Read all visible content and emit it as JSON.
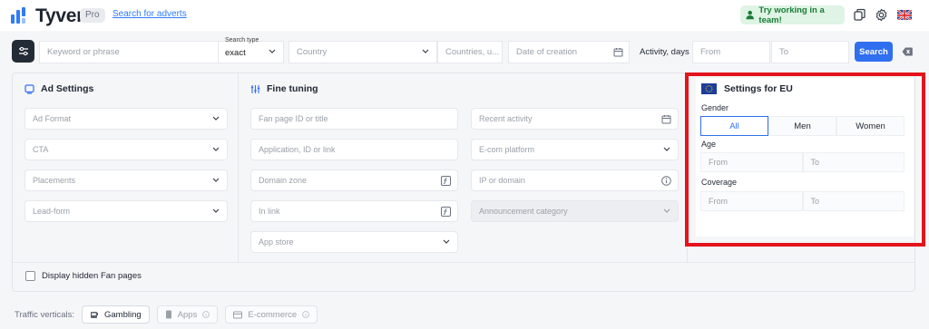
{
  "header": {
    "brand": "Tyver",
    "badge": "Pro",
    "search_link": "Search for adverts",
    "team_button": "Try working in a team!",
    "icons": [
      "user-icon",
      "copy-icon",
      "gear-icon",
      "uk-flag-icon"
    ]
  },
  "filters": {
    "keyword_placeholder": "Keyword or phrase",
    "search_type_label": "Search type",
    "search_type_value": "exact",
    "country_placeholder": "Country",
    "countries_placeholder": "Countries, u...",
    "date_placeholder": "Date of creation",
    "activity_label": "Activity, days",
    "from_placeholder": "From",
    "to_placeholder": "To",
    "search_button": "Search"
  },
  "ad_settings": {
    "title": "Ad Settings",
    "fields": [
      "Ad Format",
      "CTA",
      "Placements",
      "Lead-form"
    ]
  },
  "fine_tuning": {
    "title": "Fine tuning",
    "left_fields": [
      "Fan page ID or title",
      "Application, ID or link",
      "Domain zone",
      "In link",
      "App store"
    ],
    "right_fields": [
      "Recent activity",
      "E-com platform",
      "IP or domain",
      "Announcement category"
    ]
  },
  "eu_settings": {
    "title": "Settings for EU",
    "gender_label": "Gender",
    "gender_options": [
      "All",
      "Men",
      "Women"
    ],
    "gender_selected": "All",
    "age_label": "Age",
    "age_from": "From",
    "age_to": "To",
    "coverage_label": "Coverage",
    "coverage_from": "From",
    "coverage_to": "To"
  },
  "display_hidden": "Display hidden Fan pages",
  "traffic": {
    "label": "Traffic verticals:",
    "chips": [
      "Gambling",
      "Apps",
      "E-commerce"
    ]
  },
  "colors": {
    "accent": "#2f6ff0",
    "highlight_frame": "#e3141b",
    "team_bg": "#dff4e4",
    "team_text": "#1b7c3a"
  }
}
